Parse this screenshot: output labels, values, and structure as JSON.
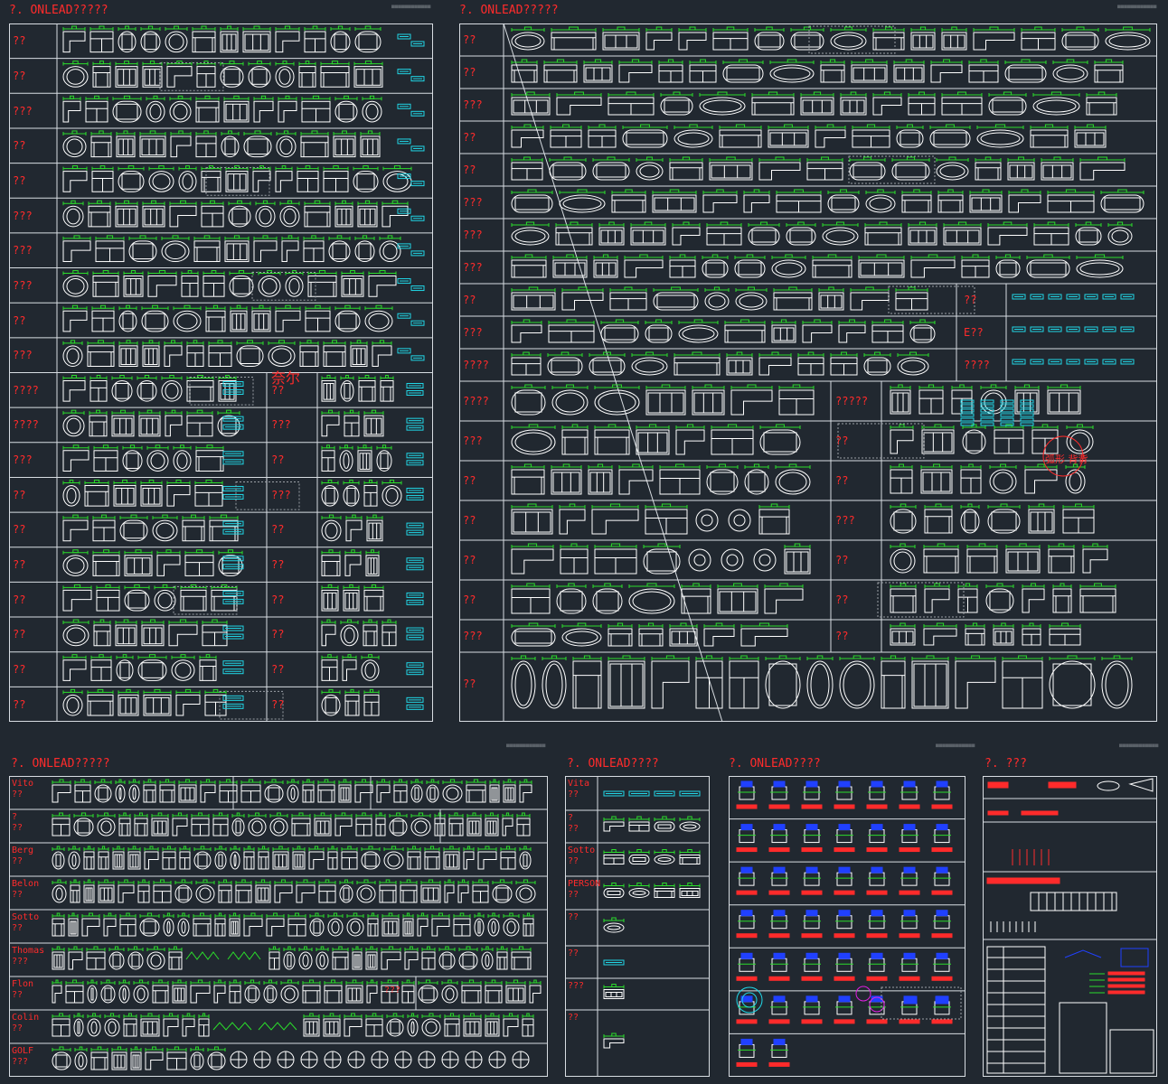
{
  "sheets": {
    "top_left_title": "?. ONLEAD?????",
    "top_right_title": "?. ONLEAD?????",
    "bottom_1_title": "?. ONLEAD?????",
    "bottom_2_title": "?. ONLEAD????",
    "bottom_3_title": "?. ONLEAD????",
    "bottom_4_title": "?. ???"
  },
  "top_left_rows": [
    "??",
    "??",
    "???",
    "??",
    "??",
    "???",
    "???",
    "???",
    "??",
    "???",
    "????",
    "????",
    "???",
    "??",
    "??",
    "??",
    "??",
    "??",
    "??",
    "??"
  ],
  "top_left_inner_labels": [
    "??",
    "???",
    "??",
    "???",
    "??",
    "??",
    "??",
    "??",
    "??"
  ],
  "top_left_note": "奈尔",
  "top_right_rows": [
    "??",
    "??",
    "???",
    "??",
    "??",
    "???",
    "???",
    "???",
    "??",
    "???",
    "????",
    "????",
    "???",
    "??",
    "??",
    "??",
    "??",
    "???",
    "??"
  ],
  "top_right_inner_labels": [
    "??",
    "E??",
    "????",
    "?????",
    "??",
    "??",
    "???",
    "??",
    "??",
    "??"
  ],
  "top_right_circle_note": "弧形 背背",
  "bottom_1_rows": [
    {
      "name": "Vito",
      "sub": "??"
    },
    {
      "name": "?",
      "sub": "??"
    },
    {
      "name": "Berg",
      "sub": "??"
    },
    {
      "name": "Belon",
      "sub": "??"
    },
    {
      "name": "Sotto",
      "sub": "??"
    },
    {
      "name": "Thomas",
      "sub": "???"
    },
    {
      "name": "Flon",
      "sub": "??"
    },
    {
      "name": "Colin",
      "sub": "??"
    },
    {
      "name": "GOLF",
      "sub": "???"
    }
  ],
  "bottom_1_inner_label": "???",
  "bottom_2_rows": [
    {
      "name": "Vita",
      "sub": "??"
    },
    {
      "name": "?",
      "sub": "??"
    },
    {
      "name": "Sotto",
      "sub": "??"
    },
    {
      "name": "PERSON",
      "sub": "??"
    },
    {
      "name": "??",
      "sub": ""
    },
    {
      "name": "??",
      "sub": ""
    },
    {
      "name": "???",
      "sub": ""
    },
    {
      "name": "??",
      "sub": ""
    }
  ],
  "colors": {
    "background": "#212830",
    "frame": "#d8dde2",
    "furniture": "#ffffff",
    "dimension": "#2bdc2b",
    "accent": "#21d6e6",
    "label": "#ff2b2b",
    "chair": "#2040ff",
    "magenta": "#e020e0"
  }
}
